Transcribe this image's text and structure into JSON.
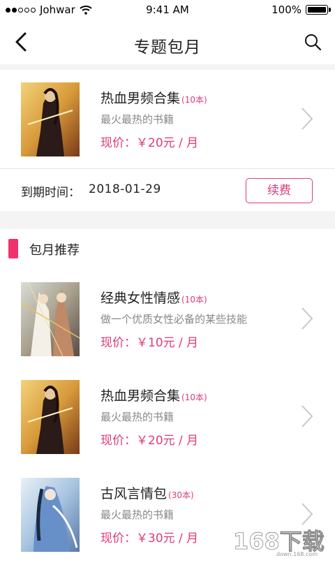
{
  "status_bar": {
    "carrier": "Johwar",
    "time": "9:41 AM",
    "battery": "100%"
  },
  "nav": {
    "title": "专题包月",
    "back_icon": "chevron-left-icon",
    "search_icon": "search-icon"
  },
  "subscription": {
    "book": {
      "title": "热血男频合集",
      "count": "(10本)",
      "desc": "最火最热的书籍",
      "price": "现价：￥20元 / 月"
    },
    "expiry_label": "到期时间：",
    "expiry_date": "2018-01-29",
    "renew_label": "续费"
  },
  "recommend": {
    "section_title": "包月推荐",
    "items": [
      {
        "title": "经典女性情感",
        "count": "(10本)",
        "desc": "做一个优质女性必备的某些技能",
        "price": "现价：￥10元 / 月"
      },
      {
        "title": "热血男频合集",
        "count": "(10本)",
        "desc": "最火最热的书籍",
        "price": "现价：￥20元 / 月"
      },
      {
        "title": "古风言情包",
        "count": "(30本)",
        "desc": "最火最热的书籍",
        "price": "现价：￥30元 / 月"
      }
    ]
  },
  "watermark": {
    "brand": "168下载",
    "url": "down.168.com"
  },
  "colors": {
    "accent": "#e0397a",
    "section_bar": "#f0326c",
    "background_band": "#f4f4f4"
  }
}
